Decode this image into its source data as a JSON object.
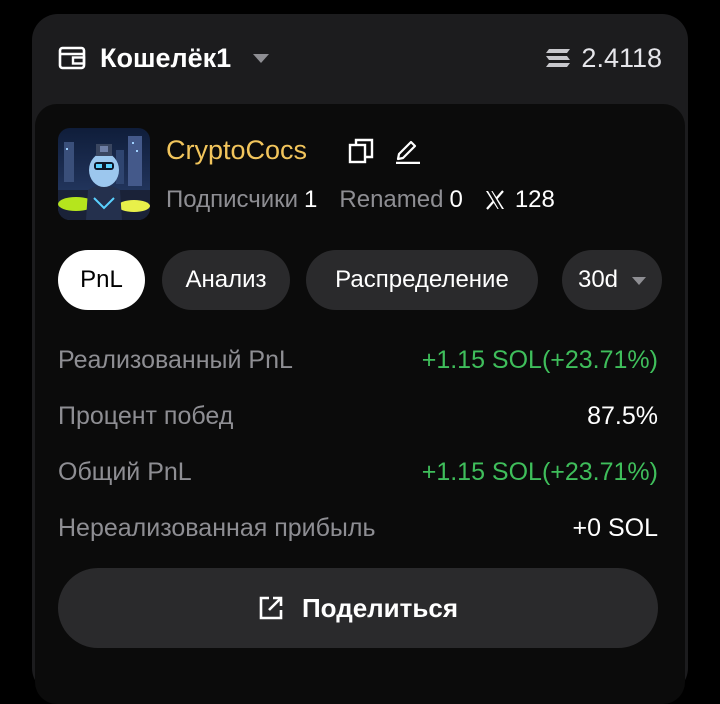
{
  "header": {
    "wallet_name": "Кошелёк1",
    "sol_balance": "2.4118"
  },
  "profile": {
    "name": "CryptoCocs",
    "followers_label": "Подписчики",
    "followers_value": "1",
    "renamed_label": "Renamed",
    "renamed_value": "0",
    "x_followers_value": "128"
  },
  "tabs": [
    {
      "label": "PnL",
      "active": true
    },
    {
      "label": "Анализ",
      "active": false
    },
    {
      "label": "Распределение",
      "active": false
    }
  ],
  "period": {
    "selected": "30d"
  },
  "metrics": [
    {
      "label": "Реализованный PnL",
      "value": "+1.15 SOL(+23.71%)",
      "status": "positive"
    },
    {
      "label": "Процент побед",
      "value": "87.5%",
      "status": "neutral"
    },
    {
      "label": "Общий PnL",
      "value": "+1.15 SOL(+23.71%)",
      "status": "positive"
    },
    {
      "label": "Нереализованная прибыль",
      "value": "+0 SOL",
      "status": "neutral"
    }
  ],
  "share": {
    "label": "Поделиться"
  },
  "colors": {
    "positive": "#3fbe5b",
    "profile_name": "#f2c55c",
    "panel_bg": "#1c1c1e",
    "card_bg": "#0b0b0b"
  },
  "icons": {
    "wallet": "wallet-icon",
    "sol": "solana-icon",
    "copy": "copy-icon",
    "edit": "edit-pencil-icon",
    "x": "x-logo-icon",
    "share": "share-external-icon"
  }
}
